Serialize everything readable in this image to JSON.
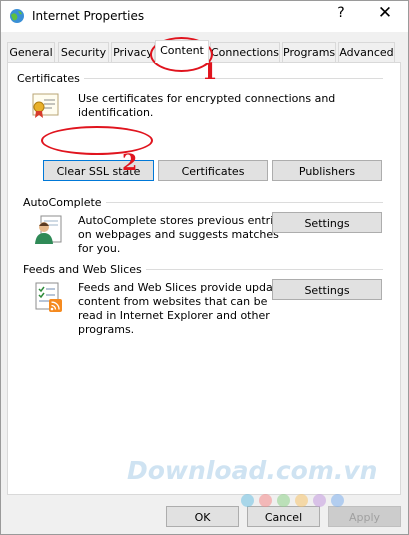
{
  "window": {
    "title": "Internet Properties",
    "help_glyph": "?",
    "close_glyph": "✕"
  },
  "tabs": [
    {
      "label": "General"
    },
    {
      "label": "Security"
    },
    {
      "label": "Privacy"
    },
    {
      "label": "Content"
    },
    {
      "label": "Connections"
    },
    {
      "label": "Programs"
    },
    {
      "label": "Advanced"
    }
  ],
  "active_tab": "Content",
  "certificates": {
    "heading": "Certificates",
    "description": "Use certificates for encrypted connections and identification.",
    "clear_ssl_label": "Clear SSL state",
    "certificates_label": "Certificates",
    "publishers_label": "Publishers"
  },
  "autocomplete": {
    "heading": "AutoComplete",
    "description": [
      "AutoComplete stores previous entries",
      "on webpages and suggests matches",
      "for you."
    ],
    "settings_label": "Settings"
  },
  "feeds": {
    "heading": "Feeds and Web Slices",
    "description": [
      "Feeds and Web Slices provide updated",
      "content from websites that can be",
      "read in Internet Explorer and other",
      "programs."
    ],
    "settings_label": "Settings"
  },
  "footer": {
    "ok_label": "OK",
    "cancel_label": "Cancel",
    "apply_label": "Apply"
  },
  "annotations": {
    "step1": "1",
    "step2": "2"
  },
  "watermark": {
    "text": "Download.com.vn"
  },
  "colors": {
    "annotation_red": "#e0141e",
    "focus_blue": "#0078d7"
  }
}
